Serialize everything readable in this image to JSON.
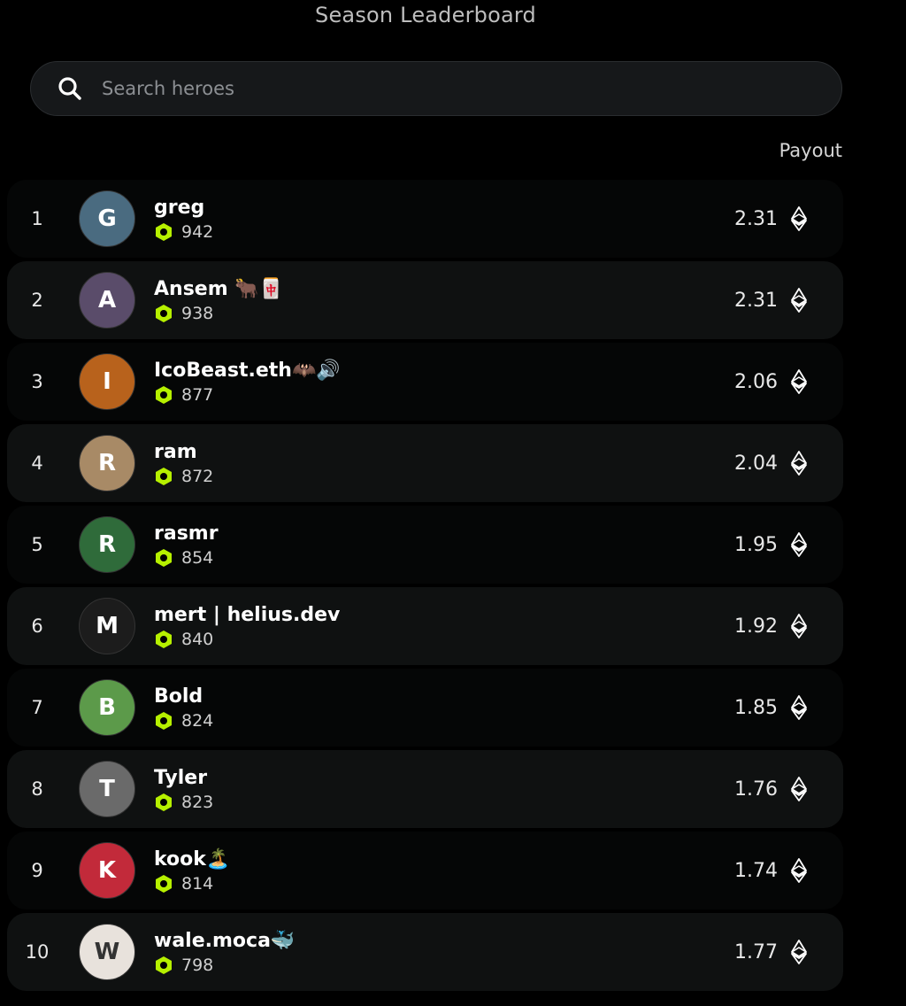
{
  "header": {
    "title": "Season Leaderboard"
  },
  "search": {
    "placeholder": "Search heroes",
    "icon": "search-icon"
  },
  "columns": {
    "payout": "Payout"
  },
  "colors": {
    "accent_green": "#b6f000",
    "background": "#000000",
    "row_alt": "#0f1111"
  },
  "rows": [
    {
      "rank": "1",
      "name": "greg",
      "points": "942",
      "payout": "2.31",
      "avatar_initial": "G",
      "avatar_color": "#4a6b80"
    },
    {
      "rank": "2",
      "name": "Ansem 🐂🀄",
      "points": "938",
      "payout": "2.31",
      "avatar_initial": "A",
      "avatar_color": "#5a4c6a"
    },
    {
      "rank": "3",
      "name": "IcoBeast.eth🦇🔊",
      "points": "877",
      "payout": "2.06",
      "avatar_initial": "I",
      "avatar_color": "#b8621c"
    },
    {
      "rank": "4",
      "name": "ram",
      "points": "872",
      "payout": "2.04",
      "avatar_initial": "R",
      "avatar_color": "#a88a66"
    },
    {
      "rank": "5",
      "name": "rasmr",
      "points": "854",
      "payout": "1.95",
      "avatar_initial": "R",
      "avatar_color": "#2f6b3a"
    },
    {
      "rank": "6",
      "name": "mert | helius.dev",
      "points": "840",
      "payout": "1.92",
      "avatar_initial": "M",
      "avatar_color": "#1c1c1c"
    },
    {
      "rank": "7",
      "name": "Bold",
      "points": "824",
      "payout": "1.85",
      "avatar_initial": "B",
      "avatar_color": "#5c9a4a"
    },
    {
      "rank": "8",
      "name": "Tyler",
      "points": "823",
      "payout": "1.76",
      "avatar_initial": "T",
      "avatar_color": "#6a6a6a"
    },
    {
      "rank": "9",
      "name": "kook🏝️",
      "points": "814",
      "payout": "1.74",
      "avatar_initial": "K",
      "avatar_color": "#c22a3a"
    },
    {
      "rank": "10",
      "name": "wale.moca🐳",
      "points": "798",
      "payout": "1.77",
      "avatar_initial": "W",
      "avatar_color": "#e8e2dc"
    }
  ]
}
